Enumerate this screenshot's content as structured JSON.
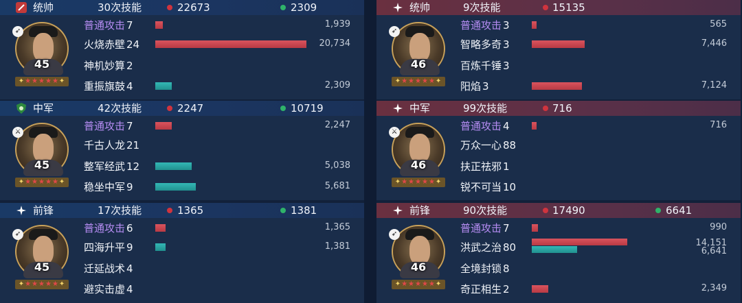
{
  "colors": {
    "damage": "#d0343e",
    "healing": "#2fb36a",
    "basic_attack": "#b58cf2"
  },
  "left_team": [
    {
      "rank": "统帅",
      "rank_icon": "red-banner-icon",
      "skills_total": "30次技能",
      "damage": "22673",
      "healing": "2309",
      "level": "45",
      "type_icon": "bow-icon",
      "skills": [
        {
          "name": "普通攻击",
          "count": "7",
          "basic": true,
          "damage": "1,939",
          "damage_pct": 4.9
        },
        {
          "name": "火烧赤壁",
          "count": "24",
          "damage": "20,734",
          "damage_pct": 100
        },
        {
          "name": "神机妙算",
          "count": "2"
        },
        {
          "name": "重振旗鼓",
          "count": "4",
          "healing": "2,309",
          "healing_pct": 11
        }
      ]
    },
    {
      "rank": "中军",
      "rank_icon": "green-shield-icon",
      "skills_total": "42次技能",
      "damage": "2247",
      "healing": "10719",
      "level": "45",
      "type_icon": "cavalry-icon",
      "skills": [
        {
          "name": "普通攻击",
          "count": "7",
          "basic": true,
          "damage": "2,247",
          "damage_pct": 11
        },
        {
          "name": "千古人龙",
          "count": "21"
        },
        {
          "name": "整军经武",
          "count": "12",
          "healing": "5,038",
          "healing_pct": 24
        },
        {
          "name": "稳坐中军",
          "count": "9",
          "healing": "5,681",
          "healing_pct": 27
        }
      ]
    },
    {
      "rank": "前锋",
      "rank_icon": "sparkle-icon",
      "skills_total": "17次技能",
      "damage": "1365",
      "healing": "1381",
      "level": "45",
      "type_icon": "bow-icon",
      "skills": [
        {
          "name": "普通攻击",
          "count": "6",
          "basic": true,
          "damage": "1,365",
          "damage_pct": 7
        },
        {
          "name": "四海升平",
          "count": "9",
          "healing": "1,381",
          "healing_pct": 7
        },
        {
          "name": "迁延战术",
          "count": "4"
        },
        {
          "name": "避实击虚",
          "count": "4"
        }
      ]
    }
  ],
  "right_team": [
    {
      "rank": "统帅",
      "rank_icon": "sparkle-icon",
      "skills_total": "9次技能",
      "damage": "15135",
      "level": "46",
      "type_icon": "bow-icon",
      "skills": [
        {
          "name": "普通攻击",
          "count": "3",
          "basic": true,
          "damage": "565",
          "damage_pct": 3
        },
        {
          "name": "智略多奇",
          "count": "3",
          "damage": "7,446",
          "damage_pct": 35
        },
        {
          "name": "百炼千锤",
          "count": "3"
        },
        {
          "name": "阳焰",
          "count": "3",
          "damage": "7,124",
          "damage_pct": 33
        }
      ]
    },
    {
      "rank": "中军",
      "rank_icon": "sparkle-icon",
      "skills_total": "99次技能",
      "damage": "716",
      "level": "46",
      "type_icon": "cavalry-icon",
      "skills": [
        {
          "name": "普通攻击",
          "count": "4",
          "basic": true,
          "damage": "716",
          "damage_pct": 3
        },
        {
          "name": "万众一心",
          "count": "88"
        },
        {
          "name": "扶正祛邪",
          "count": "1"
        },
        {
          "name": "锐不可当",
          "count": "10"
        }
      ]
    },
    {
      "rank": "前锋",
      "rank_icon": "sparkle-icon",
      "skills_total": "90次技能",
      "damage": "17490",
      "healing": "6641",
      "level": "46",
      "type_icon": "bow-icon",
      "skills": [
        {
          "name": "普通攻击",
          "count": "7",
          "basic": true,
          "damage": "990",
          "damage_pct": 4
        },
        {
          "name": "洪武之治",
          "count": "80",
          "damage": "14,151",
          "damage_pct": 63,
          "healing": "6,641",
          "healing_pct": 30
        },
        {
          "name": "全境封锁",
          "count": "8"
        },
        {
          "name": "奇正相生",
          "count": "2",
          "damage": "2,349",
          "damage_pct": 11
        }
      ]
    }
  ]
}
